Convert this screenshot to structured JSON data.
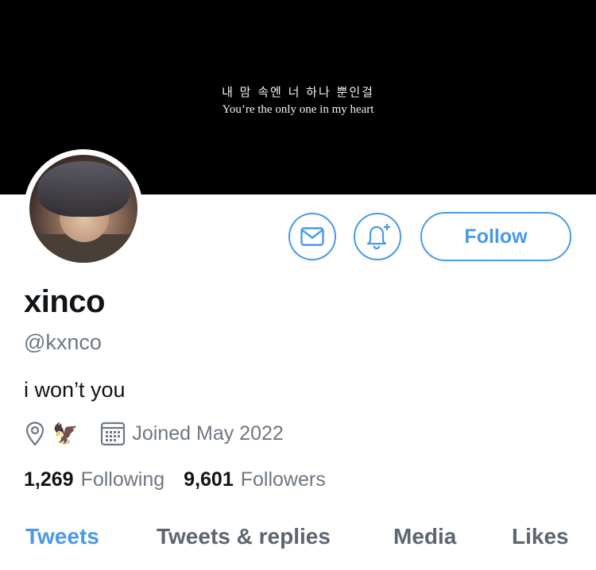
{
  "banner": {
    "korean_text": "내 맘 속엔 너 하나 뿐인걸",
    "english_text": "You’re the only one in my heart"
  },
  "profile": {
    "name": "xinco",
    "handle": "@kxnco",
    "bio": "i won’t you",
    "location_emoji": "🦅",
    "joined": "Joined May 2022"
  },
  "actions": {
    "message_icon": "envelope-icon",
    "notify_icon": "bell-plus-icon",
    "follow_label": "Follow"
  },
  "stats": {
    "following_count": "1,269",
    "following_label": "Following",
    "followers_count": "9,601",
    "followers_label": "Followers"
  },
  "tabs": [
    {
      "label": "Tweets",
      "active": true
    },
    {
      "label": "Tweets & replies",
      "active": false
    },
    {
      "label": "Media",
      "active": false
    },
    {
      "label": "Likes",
      "active": false
    }
  ],
  "colors": {
    "accent": "#4a99e9",
    "secondary_text": "#6e7781",
    "primary_text": "#0f1419",
    "banner": "#000000"
  }
}
